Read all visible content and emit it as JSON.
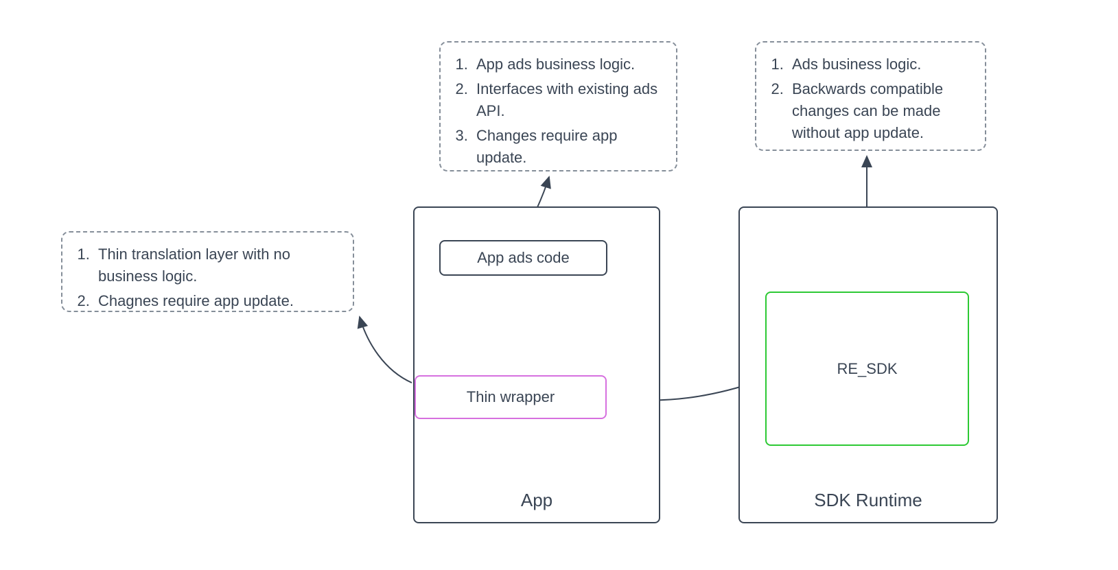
{
  "notes": {
    "left": {
      "item1": "Thin translation layer with no business logic.",
      "item2": "Chagnes require app update."
    },
    "top_center": {
      "item1": "App ads business logic.",
      "item2": "Interfaces with existing ads API.",
      "item3": "Changes require app update."
    },
    "top_right": {
      "item1": "Ads business logic.",
      "item2": "Backwards compatible changes can be made without app update."
    }
  },
  "containers": {
    "app": {
      "label": "App"
    },
    "sdk": {
      "label": "SDK Runtime"
    }
  },
  "boxes": {
    "app_ads_code": "App ads code",
    "thin_wrapper": "Thin wrapper",
    "re_sdk": "RE_SDK"
  }
}
